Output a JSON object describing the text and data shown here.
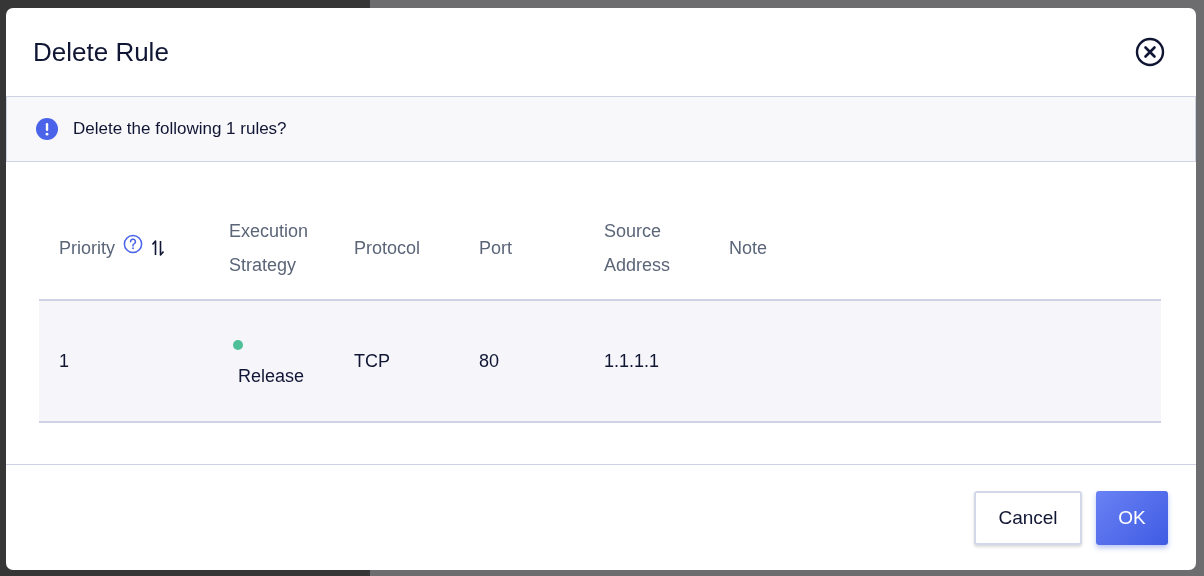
{
  "dialog": {
    "title": "Delete Rule"
  },
  "alert": {
    "message": "Delete the following 1 rules?"
  },
  "table": {
    "columns": [
      {
        "label": "Priority",
        "help": true,
        "sortable": true
      },
      {
        "label": "Execution Strategy",
        "help": false,
        "sortable": false
      },
      {
        "label": "Protocol",
        "help": false,
        "sortable": false
      },
      {
        "label": "Port",
        "help": false,
        "sortable": false
      },
      {
        "label": "Source Address",
        "help": false,
        "sortable": false
      },
      {
        "label": "Note",
        "help": false,
        "sortable": false
      }
    ],
    "rows": [
      {
        "priority": "1",
        "strategy": {
          "label": "Release",
          "color": "#4fbf98"
        },
        "protocol": "TCP",
        "port": "80",
        "source": "1.1.1.1"
      }
    ]
  },
  "buttons": [
    {
      "label": "Cancel",
      "kind": "secondary"
    },
    {
      "label": "OK",
      "kind": "primary"
    }
  ]
}
